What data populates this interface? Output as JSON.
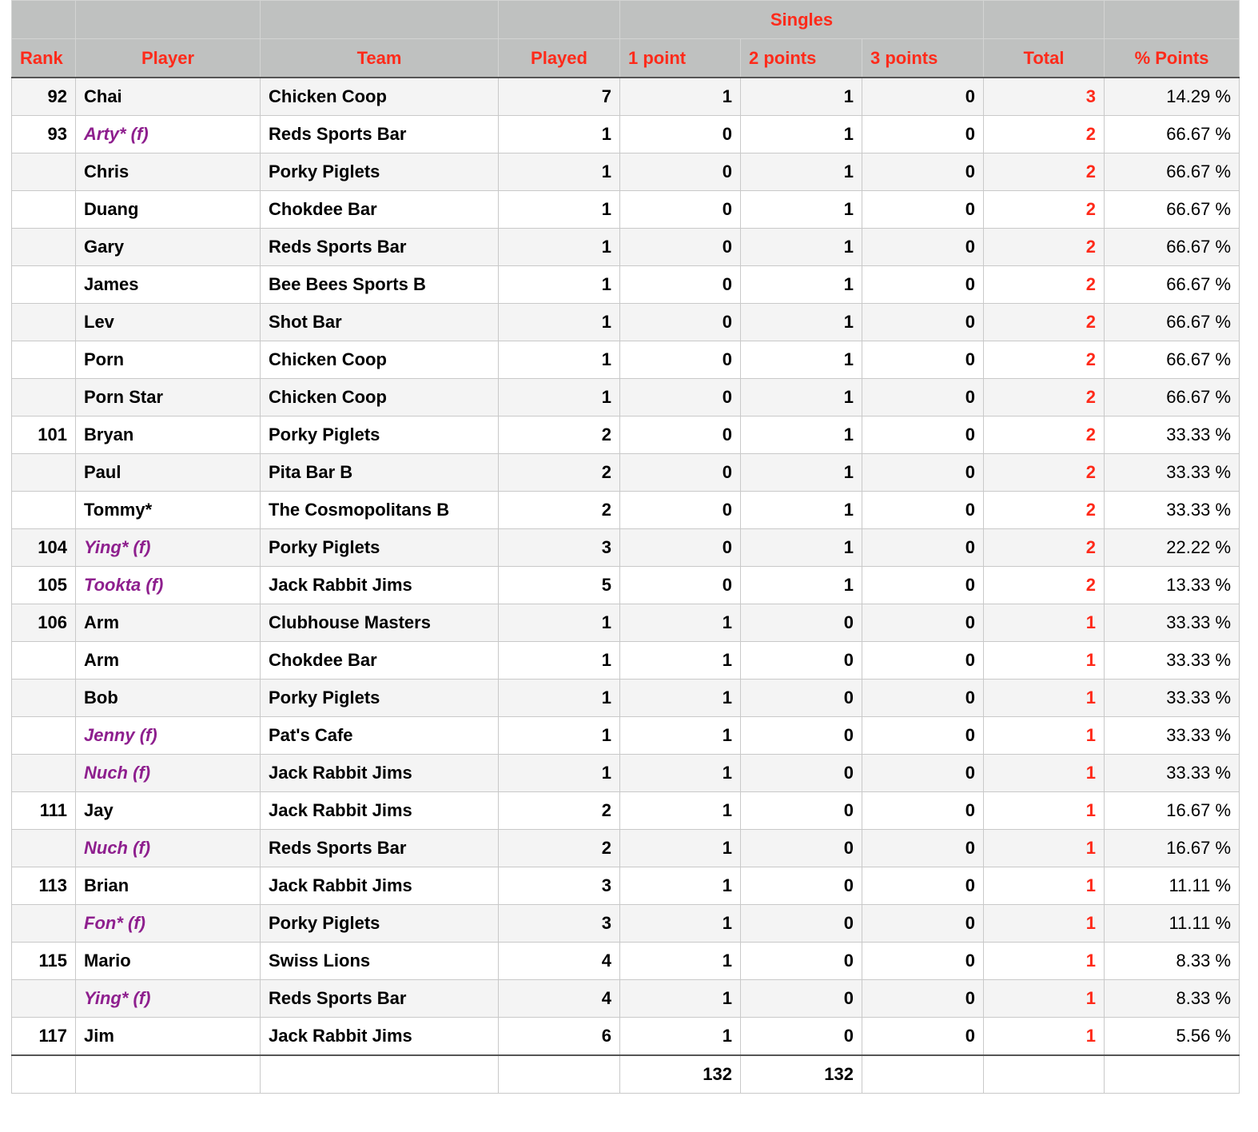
{
  "header": {
    "group_label": "Singles",
    "columns": [
      "Rank",
      "Player",
      "Team",
      "Played",
      "1 point",
      "2 points",
      "3 points",
      "Total",
      "% Points"
    ]
  },
  "colors": {
    "header_text": "#ff2a1a",
    "header_bg": "#bfc1c0",
    "female_player": "#8e1f8e",
    "total_text": "#ff2a1a"
  },
  "rows": [
    {
      "rank": "92",
      "player": "Chai",
      "female": false,
      "team": "Chicken Coop",
      "played": "7",
      "p1": "1",
      "p2": "1",
      "p3": "0",
      "total": "3",
      "pct": "14.29 %"
    },
    {
      "rank": "93",
      "player": "Arty* (f)",
      "female": true,
      "team": "Reds Sports Bar",
      "played": "1",
      "p1": "0",
      "p2": "1",
      "p3": "0",
      "total": "2",
      "pct": "66.67 %"
    },
    {
      "rank": "",
      "player": "Chris",
      "female": false,
      "team": "Porky Piglets",
      "played": "1",
      "p1": "0",
      "p2": "1",
      "p3": "0",
      "total": "2",
      "pct": "66.67 %"
    },
    {
      "rank": "",
      "player": "Duang",
      "female": false,
      "team": "Chokdee Bar",
      "played": "1",
      "p1": "0",
      "p2": "1",
      "p3": "0",
      "total": "2",
      "pct": "66.67 %"
    },
    {
      "rank": "",
      "player": "Gary",
      "female": false,
      "team": "Reds Sports Bar",
      "played": "1",
      "p1": "0",
      "p2": "1",
      "p3": "0",
      "total": "2",
      "pct": "66.67 %"
    },
    {
      "rank": "",
      "player": "James",
      "female": false,
      "team": "Bee Bees Sports B",
      "played": "1",
      "p1": "0",
      "p2": "1",
      "p3": "0",
      "total": "2",
      "pct": "66.67 %"
    },
    {
      "rank": "",
      "player": "Lev",
      "female": false,
      "team": "Shot Bar",
      "played": "1",
      "p1": "0",
      "p2": "1",
      "p3": "0",
      "total": "2",
      "pct": "66.67 %"
    },
    {
      "rank": "",
      "player": "Porn",
      "female": false,
      "team": "Chicken Coop",
      "played": "1",
      "p1": "0",
      "p2": "1",
      "p3": "0",
      "total": "2",
      "pct": "66.67 %"
    },
    {
      "rank": "",
      "player": "Porn Star",
      "female": false,
      "team": "Chicken Coop",
      "played": "1",
      "p1": "0",
      "p2": "1",
      "p3": "0",
      "total": "2",
      "pct": "66.67 %"
    },
    {
      "rank": "101",
      "player": "Bryan",
      "female": false,
      "team": "Porky Piglets",
      "played": "2",
      "p1": "0",
      "p2": "1",
      "p3": "0",
      "total": "2",
      "pct": "33.33 %"
    },
    {
      "rank": "",
      "player": "Paul",
      "female": false,
      "team": "Pita Bar B",
      "played": "2",
      "p1": "0",
      "p2": "1",
      "p3": "0",
      "total": "2",
      "pct": "33.33 %"
    },
    {
      "rank": "",
      "player": "Tommy*",
      "female": false,
      "team": "The Cosmopolitans B",
      "played": "2",
      "p1": "0",
      "p2": "1",
      "p3": "0",
      "total": "2",
      "pct": "33.33 %"
    },
    {
      "rank": "104",
      "player": "Ying* (f)",
      "female": true,
      "team": "Porky Piglets",
      "played": "3",
      "p1": "0",
      "p2": "1",
      "p3": "0",
      "total": "2",
      "pct": "22.22 %"
    },
    {
      "rank": "105",
      "player": "Tookta (f)",
      "female": true,
      "team": "Jack Rabbit Jims",
      "played": "5",
      "p1": "0",
      "p2": "1",
      "p3": "0",
      "total": "2",
      "pct": "13.33 %"
    },
    {
      "rank": "106",
      "player": "Arm",
      "female": false,
      "team": "Clubhouse Masters",
      "played": "1",
      "p1": "1",
      "p2": "0",
      "p3": "0",
      "total": "1",
      "pct": "33.33 %"
    },
    {
      "rank": "",
      "player": "Arm",
      "female": false,
      "team": "Chokdee Bar",
      "played": "1",
      "p1": "1",
      "p2": "0",
      "p3": "0",
      "total": "1",
      "pct": "33.33 %"
    },
    {
      "rank": "",
      "player": "Bob",
      "female": false,
      "team": "Porky Piglets",
      "played": "1",
      "p1": "1",
      "p2": "0",
      "p3": "0",
      "total": "1",
      "pct": "33.33 %"
    },
    {
      "rank": "",
      "player": "Jenny (f)",
      "female": true,
      "team": "Pat's Cafe",
      "played": "1",
      "p1": "1",
      "p2": "0",
      "p3": "0",
      "total": "1",
      "pct": "33.33 %"
    },
    {
      "rank": "",
      "player": "Nuch (f)",
      "female": true,
      "team": "Jack Rabbit Jims",
      "played": "1",
      "p1": "1",
      "p2": "0",
      "p3": "0",
      "total": "1",
      "pct": "33.33 %"
    },
    {
      "rank": "111",
      "player": "Jay",
      "female": false,
      "team": "Jack Rabbit Jims",
      "played": "2",
      "p1": "1",
      "p2": "0",
      "p3": "0",
      "total": "1",
      "pct": "16.67 %"
    },
    {
      "rank": "",
      "player": "Nuch (f)",
      "female": true,
      "team": "Reds Sports Bar",
      "played": "2",
      "p1": "1",
      "p2": "0",
      "p3": "0",
      "total": "1",
      "pct": "16.67 %"
    },
    {
      "rank": "113",
      "player": "Brian",
      "female": false,
      "team": "Jack Rabbit Jims",
      "played": "3",
      "p1": "1",
      "p2": "0",
      "p3": "0",
      "total": "1",
      "pct": "11.11 %"
    },
    {
      "rank": "",
      "player": "Fon* (f)",
      "female": true,
      "team": "Porky Piglets",
      "played": "3",
      "p1": "1",
      "p2": "0",
      "p3": "0",
      "total": "1",
      "pct": "11.11 %"
    },
    {
      "rank": "115",
      "player": "Mario",
      "female": false,
      "team": "Swiss Lions",
      "played": "4",
      "p1": "1",
      "p2": "0",
      "p3": "0",
      "total": "1",
      "pct": "8.33 %"
    },
    {
      "rank": "",
      "player": "Ying* (f)",
      "female": true,
      "team": "Reds Sports Bar",
      "played": "4",
      "p1": "1",
      "p2": "0",
      "p3": "0",
      "total": "1",
      "pct": "8.33 %"
    },
    {
      "rank": "117",
      "player": "Jim",
      "female": false,
      "team": "Jack Rabbit Jims",
      "played": "6",
      "p1": "1",
      "p2": "0",
      "p3": "0",
      "total": "1",
      "pct": "5.56 %"
    }
  ],
  "footer": {
    "rank": "",
    "player": "",
    "team": "",
    "played": "",
    "p1": "132",
    "p2": "132",
    "p3": "",
    "total": "",
    "pct": ""
  }
}
